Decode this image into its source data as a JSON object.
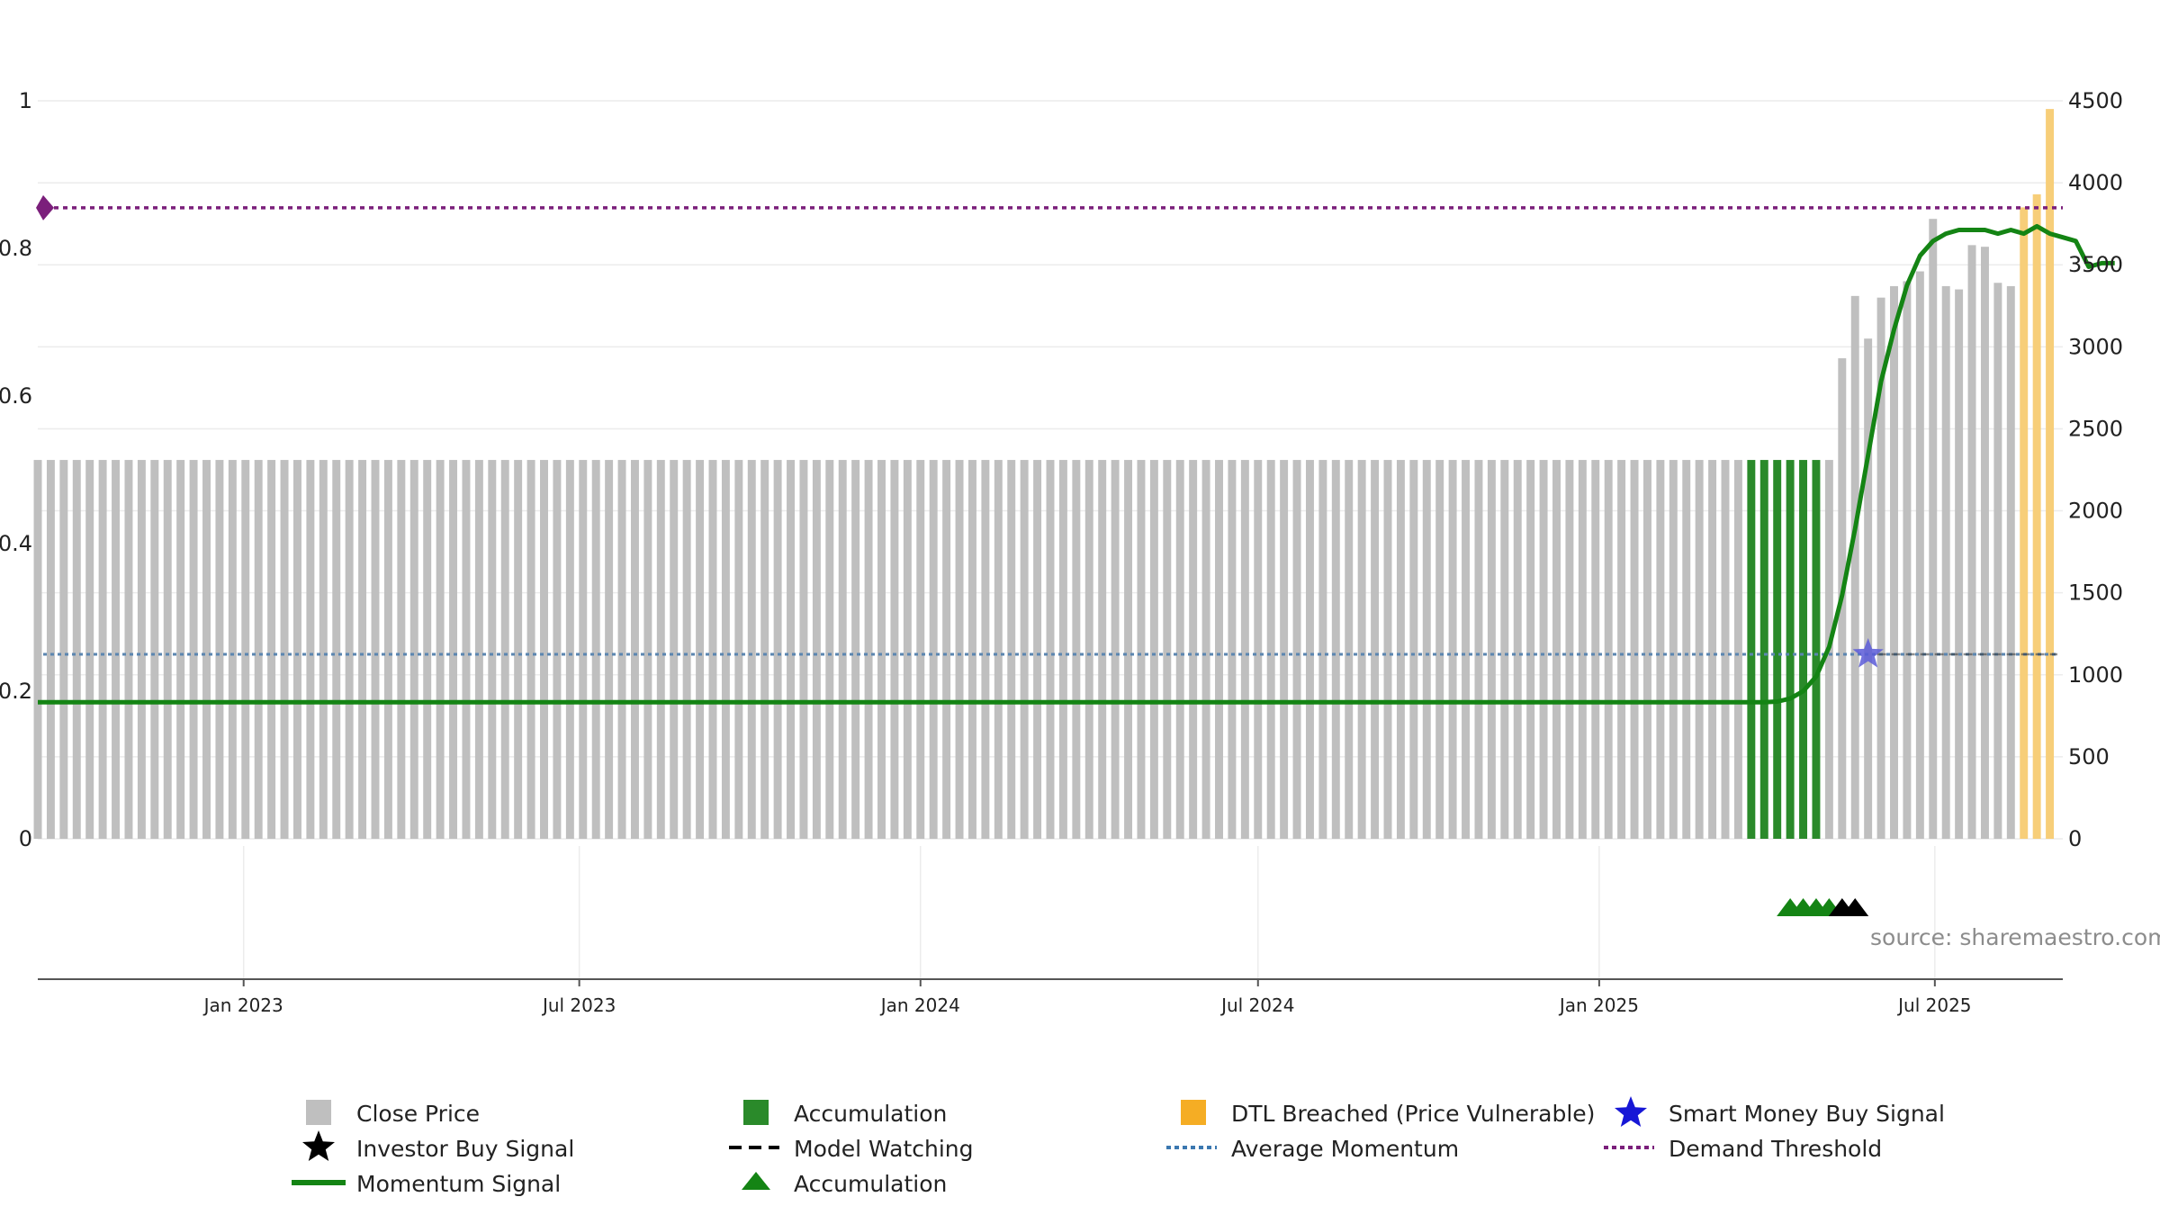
{
  "source_note": "source: sharemaestro.com",
  "colors": {
    "close_price": "#bfbfbf",
    "accumulation": "#2a8a2a",
    "dtl_breached": "#f7ce79",
    "momentum": "#148414",
    "average_momentum": "#5b86b0",
    "demand_threshold": "#7b1f7b",
    "smart_money": "#1717d6",
    "investor_signal": "#000000"
  },
  "legend": {
    "close_price": "Close Price",
    "accumulation_bar": "Accumulation",
    "dtl_breached": "DTL Breached (Price Vulnerable)",
    "smart_money": "Smart Money Buy Signal",
    "investor_buy": "Investor Buy Signal",
    "model_watching": "Model Watching",
    "average_momentum": "Average Momentum",
    "demand_threshold": "Demand Threshold",
    "momentum_signal": "Momentum Signal",
    "accumulation_marker": "Accumulation"
  },
  "chart_data": {
    "type": "bar",
    "x_axis": {
      "type": "date",
      "range": [
        "2022-09-12",
        "2025-09-08"
      ],
      "ticks": [
        {
          "date": "2023-01-01",
          "label": "Jan 2023"
        },
        {
          "date": "2023-07-01",
          "label": "Jul 2023"
        },
        {
          "date": "2024-01-01",
          "label": "Jan 2024"
        },
        {
          "date": "2024-07-01",
          "label": "Jul 2024"
        },
        {
          "date": "2025-01-01",
          "label": "Jan 2025"
        },
        {
          "date": "2025-07-01",
          "label": "Jul 2025"
        }
      ]
    },
    "y_left": {
      "range": [
        0,
        1
      ],
      "ticks": [
        "0",
        "0.2",
        "0.4",
        "0.6",
        "0.8",
        "1"
      ]
    },
    "y_right": {
      "range": [
        0,
        4500
      ],
      "ticks": [
        "0",
        "500",
        "1000",
        "1500",
        "2000",
        "2500",
        "3000",
        "3500",
        "4000",
        "4500"
      ]
    },
    "grid": true,
    "legend_position": "bottom",
    "price_series": {
      "start_date": "2022-09-12",
      "interval_days": 7,
      "flat_value": 2310,
      "flat_count": 139,
      "accumulation_weeks": [
        132,
        133,
        134,
        135,
        136,
        137
      ],
      "tail_values": [
        2930,
        3310,
        3050,
        3300,
        3370,
        3400,
        3460,
        3780,
        3370,
        3350,
        3620,
        3610,
        3390,
        3370,
        3850,
        3930,
        4450
      ],
      "dtl_breached_weeks": [
        153,
        154,
        155
      ]
    },
    "momentum_signal": {
      "start_date": "2022-09-12",
      "interval_days": 7,
      "flat_value": 0.185,
      "flat_count": 134,
      "tail_values": [
        0.186,
        0.19,
        0.2,
        0.22,
        0.26,
        0.33,
        0.42,
        0.52,
        0.62,
        0.69,
        0.75,
        0.79,
        0.81,
        0.82,
        0.825,
        0.825,
        0.825,
        0.82,
        0.825,
        0.82,
        0.83,
        0.82,
        0.815,
        0.81,
        0.775,
        0.78,
        0.78
      ]
    },
    "average_momentum": 0.25,
    "demand_threshold": 0.855,
    "signals": {
      "accumulation_markers": [
        "2025-04-14",
        "2025-04-21",
        "2025-04-28",
        "2025-05-05"
      ],
      "investor_buy": [
        "2025-05-12",
        "2025-05-19"
      ],
      "smart_money_buy": {
        "date": "2025-05-26",
        "value": 0.25
      }
    }
  }
}
